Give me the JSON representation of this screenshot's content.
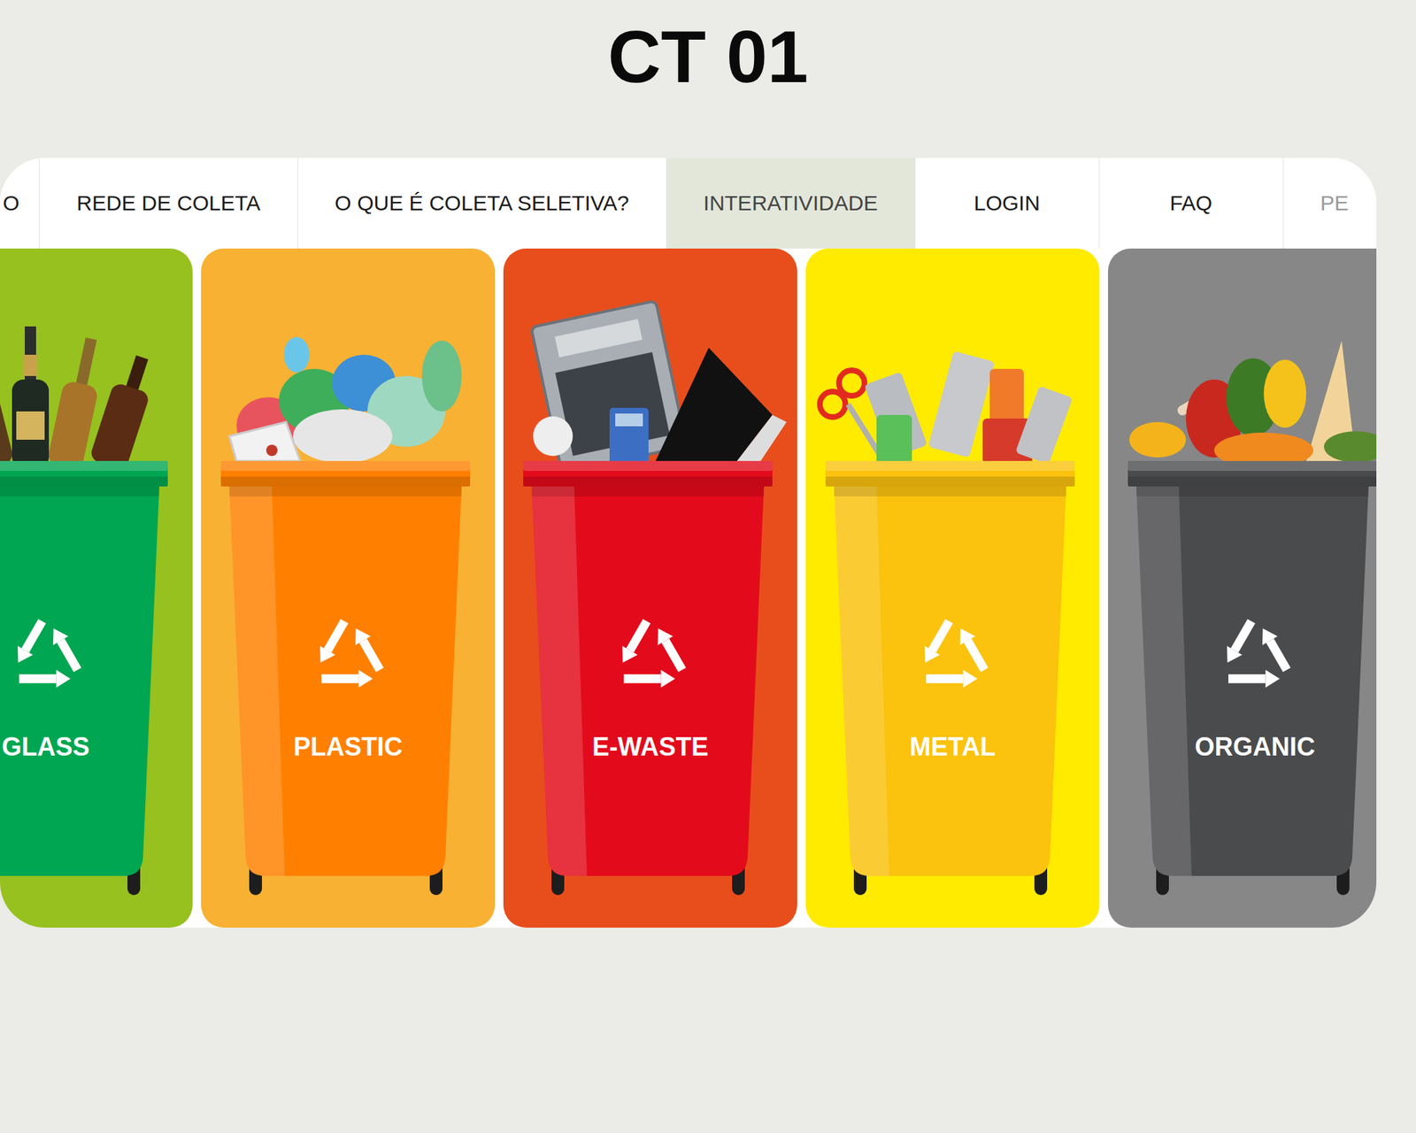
{
  "title": "CT 01",
  "nav": {
    "items": [
      {
        "label": "O",
        "selected": false,
        "disabled": false
      },
      {
        "label": "REDE DE COLETA",
        "selected": false,
        "disabled": false
      },
      {
        "label": "O QUE É COLETA SELETIVA?",
        "selected": false,
        "disabled": false
      },
      {
        "label": "INTERATIVIDADE",
        "selected": true,
        "disabled": false
      },
      {
        "label": "LOGIN",
        "selected": false,
        "disabled": false
      },
      {
        "label": "FAQ",
        "selected": false,
        "disabled": false
      },
      {
        "label": "PE",
        "selected": false,
        "disabled": true
      }
    ]
  },
  "bins": [
    {
      "label": "GLASS",
      "kind": "glass",
      "color": "#00a651",
      "card_color": "#96c11f"
    },
    {
      "label": "PLASTIC",
      "kind": "plastic",
      "color": "#ff8000",
      "card_color": "#f8b133"
    },
    {
      "label": "E-WASTE",
      "kind": "ewaste",
      "color": "#e30b1b",
      "card_color": "#e84e1c"
    },
    {
      "label": "METAL",
      "kind": "metal",
      "color": "#fbc20e",
      "card_color": "#ffeb00"
    },
    {
      "label": "ORGANIC",
      "kind": "organic",
      "color": "#4a4b4d",
      "card_color": "#878787"
    }
  ]
}
